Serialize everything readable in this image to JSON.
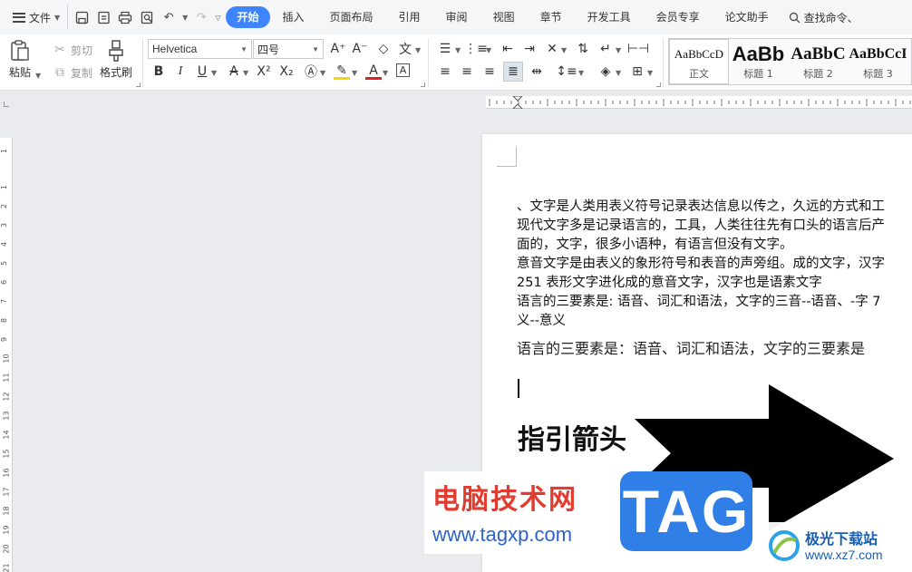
{
  "menubar": {
    "file_label": "文件",
    "tabs": [
      {
        "label": "开始",
        "active": true
      },
      {
        "label": "插入"
      },
      {
        "label": "页面布局"
      },
      {
        "label": "引用"
      },
      {
        "label": "审阅"
      },
      {
        "label": "视图"
      },
      {
        "label": "章节"
      },
      {
        "label": "开发工具"
      },
      {
        "label": "会员专享"
      },
      {
        "label": "论文助手"
      }
    ],
    "search_label": "查找命令、"
  },
  "ribbon": {
    "paste_label": "粘贴",
    "cut_label": "剪切",
    "copy_label": "复制",
    "format_painter_label": "格式刷",
    "font_name": "Helvetica",
    "font_size": "四号",
    "styles": [
      {
        "preview": "AaBbCcD",
        "label": "正文"
      },
      {
        "preview": "AaBb",
        "label": "标题 1"
      },
      {
        "preview": "AaBbC",
        "label": "标题 2"
      },
      {
        "preview": "AaBbCcI",
        "label": "标题 3"
      }
    ]
  },
  "ruler": {
    "vertical_numbers": [
      "1",
      "2",
      "3",
      "4",
      "5",
      "6",
      "7",
      "8",
      "9",
      "10",
      "11",
      "12",
      "13",
      "14",
      "15",
      "16",
      "17",
      "18",
      "19",
      "20",
      "21"
    ]
  },
  "document": {
    "lines": [
      "、文字是人类用表义符号记录表达信息以传之，久远的方式和工",
      "现代文字多是记录语言的，工具，人类往往先有口头的语言后产",
      "面的，文字，很多小语种，有语言但没有文字。",
      "意音文字是由表义的象形符号和表音的声旁组。成的文字，汉字",
      "251 表形文字进化成的意音文字，汉字也是语素文字",
      "语言的三要素是: 语音、词汇和语法，文字的三音--语音、-字  7",
      "义--意义"
    ],
    "big_line": "语言的三要素是：语音、词汇和语法，文字的三要素是",
    "heading": "指引箭头"
  },
  "watermark": {
    "site_name": "电脑技术网",
    "site_url": "www.tagxp.com",
    "tag_text": "TAG",
    "right_name": "极光下载站",
    "right_url": "www.xz7.com"
  }
}
